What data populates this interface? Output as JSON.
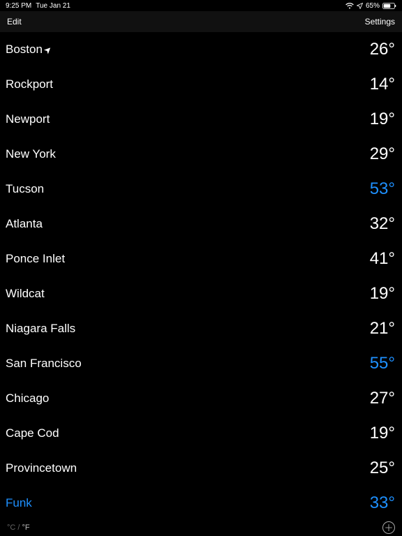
{
  "status": {
    "time": "9:25 PM",
    "date": "Tue Jan 21",
    "battery": "65%"
  },
  "nav": {
    "left": "Edit",
    "right": "Settings"
  },
  "locations": [
    {
      "name": "Boston",
      "temp": "26°",
      "current": true
    },
    {
      "name": "Rockport",
      "temp": "14°"
    },
    {
      "name": "Newport",
      "temp": "19°"
    },
    {
      "name": "New York",
      "temp": "29°"
    },
    {
      "name": "Tucson",
      "temp": "53°",
      "tempHighlight": true
    },
    {
      "name": "Atlanta",
      "temp": "32°"
    },
    {
      "name": "Ponce Inlet",
      "temp": "41°"
    },
    {
      "name": "Wildcat",
      "temp": "19°"
    },
    {
      "name": "Niagara Falls",
      "temp": "21°"
    },
    {
      "name": "San Francisco",
      "temp": "55°",
      "tempHighlight": true
    },
    {
      "name": "Chicago",
      "temp": "27°"
    },
    {
      "name": "Cape Cod",
      "temp": "19°"
    },
    {
      "name": "Provincetown",
      "temp": "25°"
    },
    {
      "name": "Funk",
      "temp": "33°",
      "highlight": true
    }
  ],
  "footer": {
    "unit_c": "°C",
    "unit_sep": " / ",
    "unit_f": "°F"
  }
}
